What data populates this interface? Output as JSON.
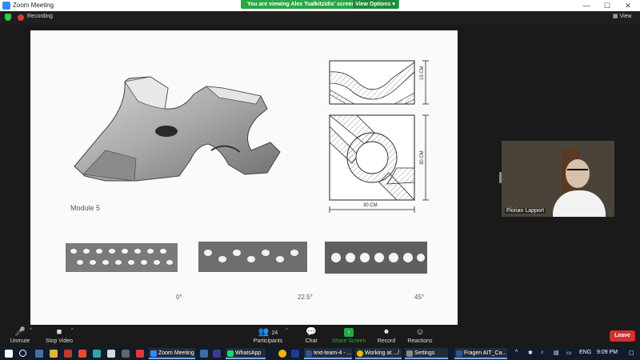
{
  "window": {
    "title": "Zoom Meeting",
    "minimize": "—",
    "maximize": "☐",
    "close": "✕"
  },
  "banner": {
    "viewing_text": "You are viewing Alex Tsalkitzidis' screen",
    "view_options": "View Options ▾"
  },
  "status": {
    "recording": "Recording",
    "view": "View"
  },
  "slide": {
    "module_label": "Module 5",
    "dim_height": "15 CM",
    "dim_side": "30 CM",
    "dim_bottom": "30 CM",
    "angles": [
      "0°",
      "22.5°",
      "45°"
    ]
  },
  "participant": {
    "name": "Florian Lapport"
  },
  "toolbar": {
    "unmute": "Unmute",
    "stop_video": "Stop Video",
    "participants": "Participants",
    "participants_count": "24",
    "chat": "Chat",
    "share_screen": "Share Screen",
    "record": "Record",
    "reactions": "Reactions",
    "leave": "Leave"
  },
  "taskbar": {
    "apps": [
      "Zoom Meeting",
      "WhatsApp",
      "text-team-4 - ...",
      "Working at .../",
      "Settings",
      "Fragen AIT_Ca..."
    ],
    "lang": "ENG",
    "time": "9:09 PM"
  },
  "colors": {
    "share_green": "#27a745",
    "leave_red": "#d32f2f",
    "zoom_blue": "#2d8cff"
  }
}
